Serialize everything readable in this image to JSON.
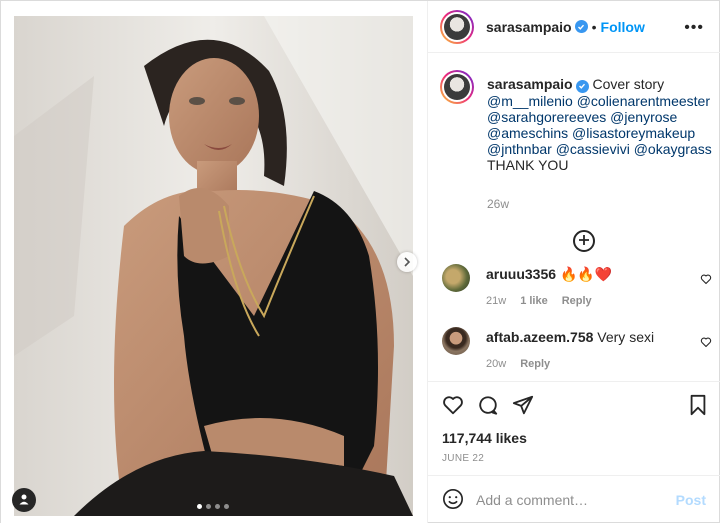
{
  "post": {
    "author": "sarasampaio",
    "follow_label": "Follow",
    "more_label": "•••",
    "caption_author": "sarasampaio",
    "caption_lead": "Cover story",
    "caption_mentions": [
      "@m__milenio",
      "@colienarentmeester",
      "@sarahgorereeves",
      "@jenyrose",
      "@ameschins",
      "@lisastoreymakeup",
      "@jnthnbar",
      "@cassievivi",
      "@okaygrass"
    ],
    "caption_end": "THANK YOU",
    "caption_time": "26w",
    "likes": "117,744 likes",
    "date": "JUNE 22",
    "carousel": {
      "slides": 4,
      "active": 0
    }
  },
  "comments": [
    {
      "user": "aruuu3356",
      "text": "🔥🔥❤️",
      "time": "21w",
      "likes": "1 like",
      "reply": "Reply"
    },
    {
      "user": "aftab.azeem.758",
      "text": "Very sexi",
      "time": "20w",
      "likes": "",
      "reply": "Reply"
    }
  ],
  "composer": {
    "placeholder": "Add a comment…",
    "post_label": "Post"
  },
  "icons": {
    "verified": "verified-badge-icon",
    "heart": "heart-icon",
    "comment": "comment-icon",
    "share": "share-icon",
    "save": "bookmark-icon",
    "emoji": "emoji-icon",
    "load_more": "plus-circle-icon",
    "next": "chevron-right-icon",
    "tags": "user-tag-icon"
  },
  "colors": {
    "link": "#0095f6",
    "mention": "#00376b",
    "muted": "#8e8e8e",
    "post_disabled": "#b3dbff"
  }
}
